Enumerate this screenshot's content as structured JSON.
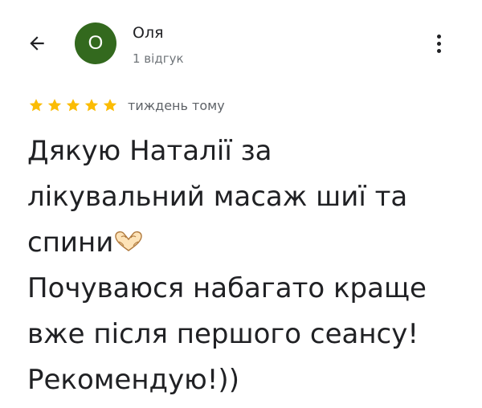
{
  "header": {
    "back_icon": "arrow-back-icon",
    "avatar_letter": "О",
    "avatar_color": "#33691e",
    "author_name": "Оля",
    "author_reviews": "1 відгук",
    "menu_icon": "more-vert-icon"
  },
  "review": {
    "rating": 5,
    "rating_max": 5,
    "star_color": "#fbbc04",
    "time_ago": "тиждень тому",
    "text_part1": "Дякую Наталії за\nлікувальний масаж шиї та\nспини",
    "emoji_icon": "heart-hands-icon",
    "text_part2": "\nПочуваюся набагато краще\nвже після першого сеансу!\nРекомендую!))"
  }
}
